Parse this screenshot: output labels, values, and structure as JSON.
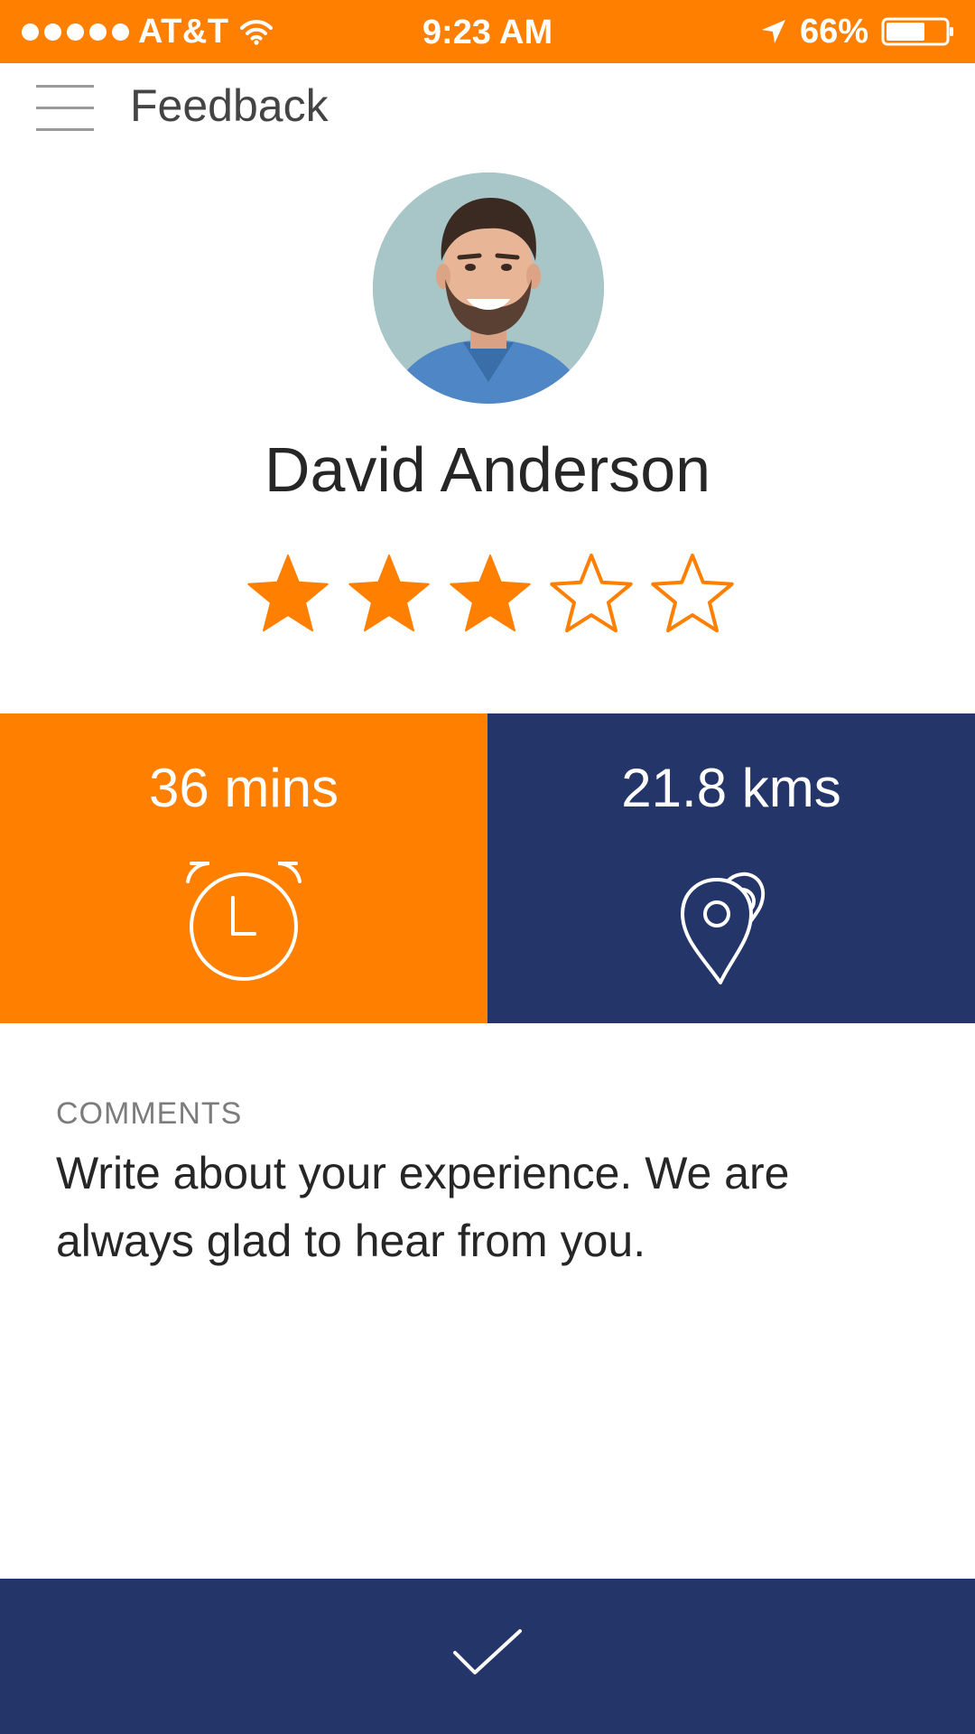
{
  "status_bar": {
    "carrier": "AT&T",
    "time": "9:23 AM",
    "battery": "66%",
    "signal_bars": 5,
    "icons": [
      "signal-dots",
      "wifi-icon",
      "location-arrow-icon",
      "battery-icon"
    ]
  },
  "header": {
    "title": "Feedback",
    "menu_icon": "hamburger-menu-icon"
  },
  "driver": {
    "name": "David Anderson",
    "avatar": "avatar-photo"
  },
  "rating": {
    "value": 3,
    "max": 5,
    "icon": "star-icon"
  },
  "stats": {
    "duration": {
      "value": "36 mins",
      "icon": "alarm-clock-icon"
    },
    "distance": {
      "value": "21.8 kms",
      "icon": "location-pin-icon"
    }
  },
  "comments": {
    "label": "COMMENTS",
    "placeholder": "Write about your experience. We are always glad to hear from you.",
    "value": ""
  },
  "submit": {
    "icon": "checkmark-icon"
  },
  "colors": {
    "accent_orange": "#FF7F00",
    "navy": "#243569",
    "text_dark": "#262626",
    "text_muted": "#7c7c7c"
  }
}
